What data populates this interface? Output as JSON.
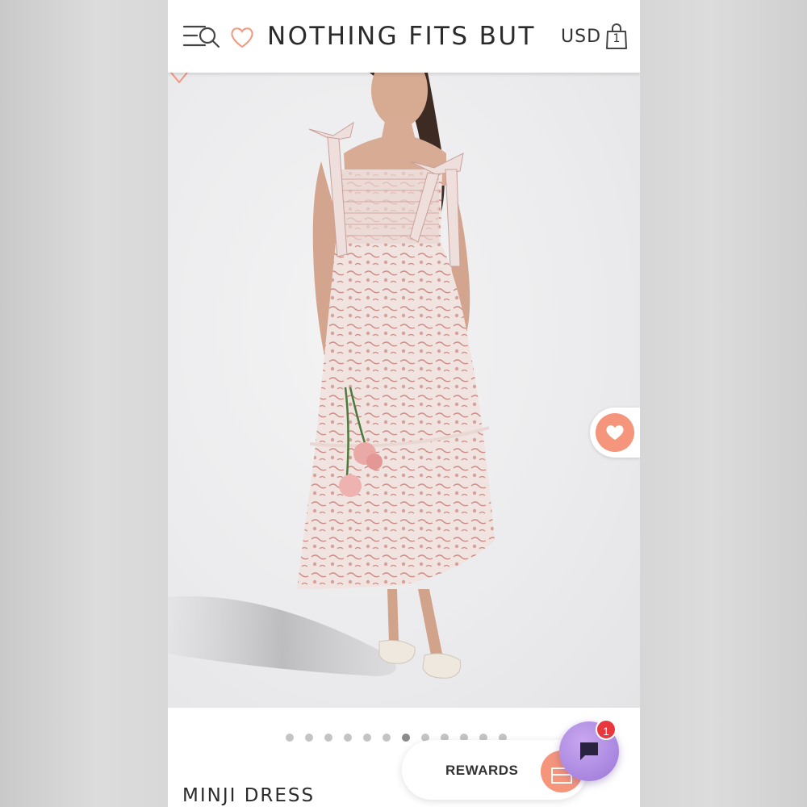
{
  "header": {
    "brand": "NOTHING FITS BUT",
    "currency": "USD",
    "cart_count": "1"
  },
  "gallery": {
    "slide_count": 12,
    "active_index": 6
  },
  "product": {
    "name": "MINJI DRESS"
  },
  "rewards": {
    "label": "REWARDS"
  },
  "chat": {
    "unread_count": "1"
  },
  "icons": {
    "menu": "menu-search-icon",
    "wishlist": "heart-icon",
    "cart": "shopping-bag-icon",
    "chat": "chat-bubble-icon",
    "rewards": "gift-icon"
  },
  "colors": {
    "accent": "#f4957c",
    "chat": "#9a78d8",
    "badge": "#e8383d"
  }
}
